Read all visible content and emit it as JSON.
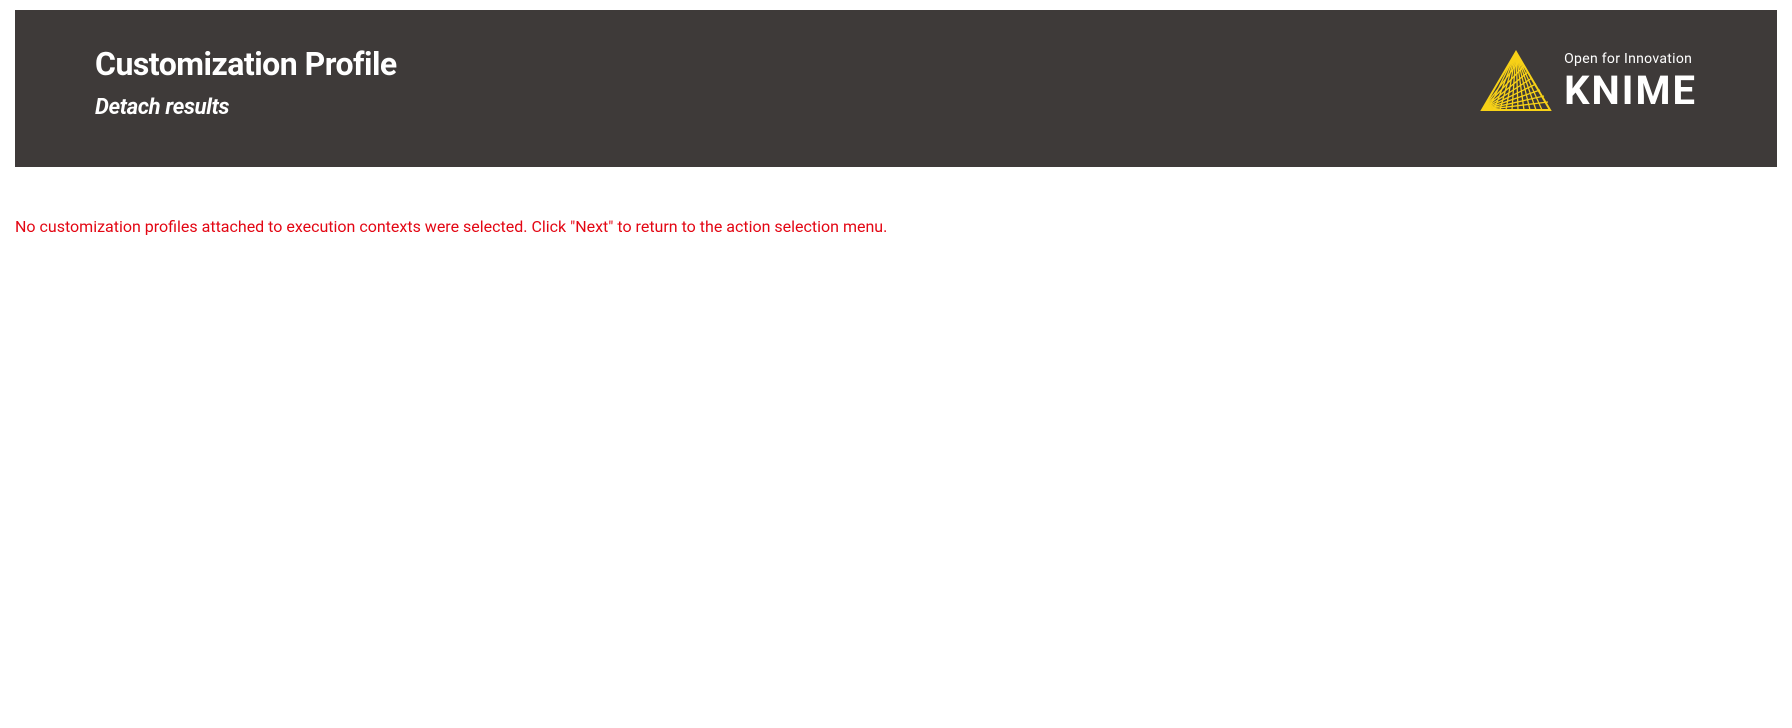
{
  "header": {
    "title": "Customization Profile",
    "subtitle": "Detach results"
  },
  "logo": {
    "tagline": "Open for Innovation",
    "brand": "KNIME"
  },
  "message": {
    "error_text": "No customization profiles attached to execution contexts were selected. Click \"Next\" to return to the action selection menu."
  },
  "colors": {
    "header_bg": "#3e3a39",
    "accent": "#f7d117",
    "error": "#e30613"
  }
}
